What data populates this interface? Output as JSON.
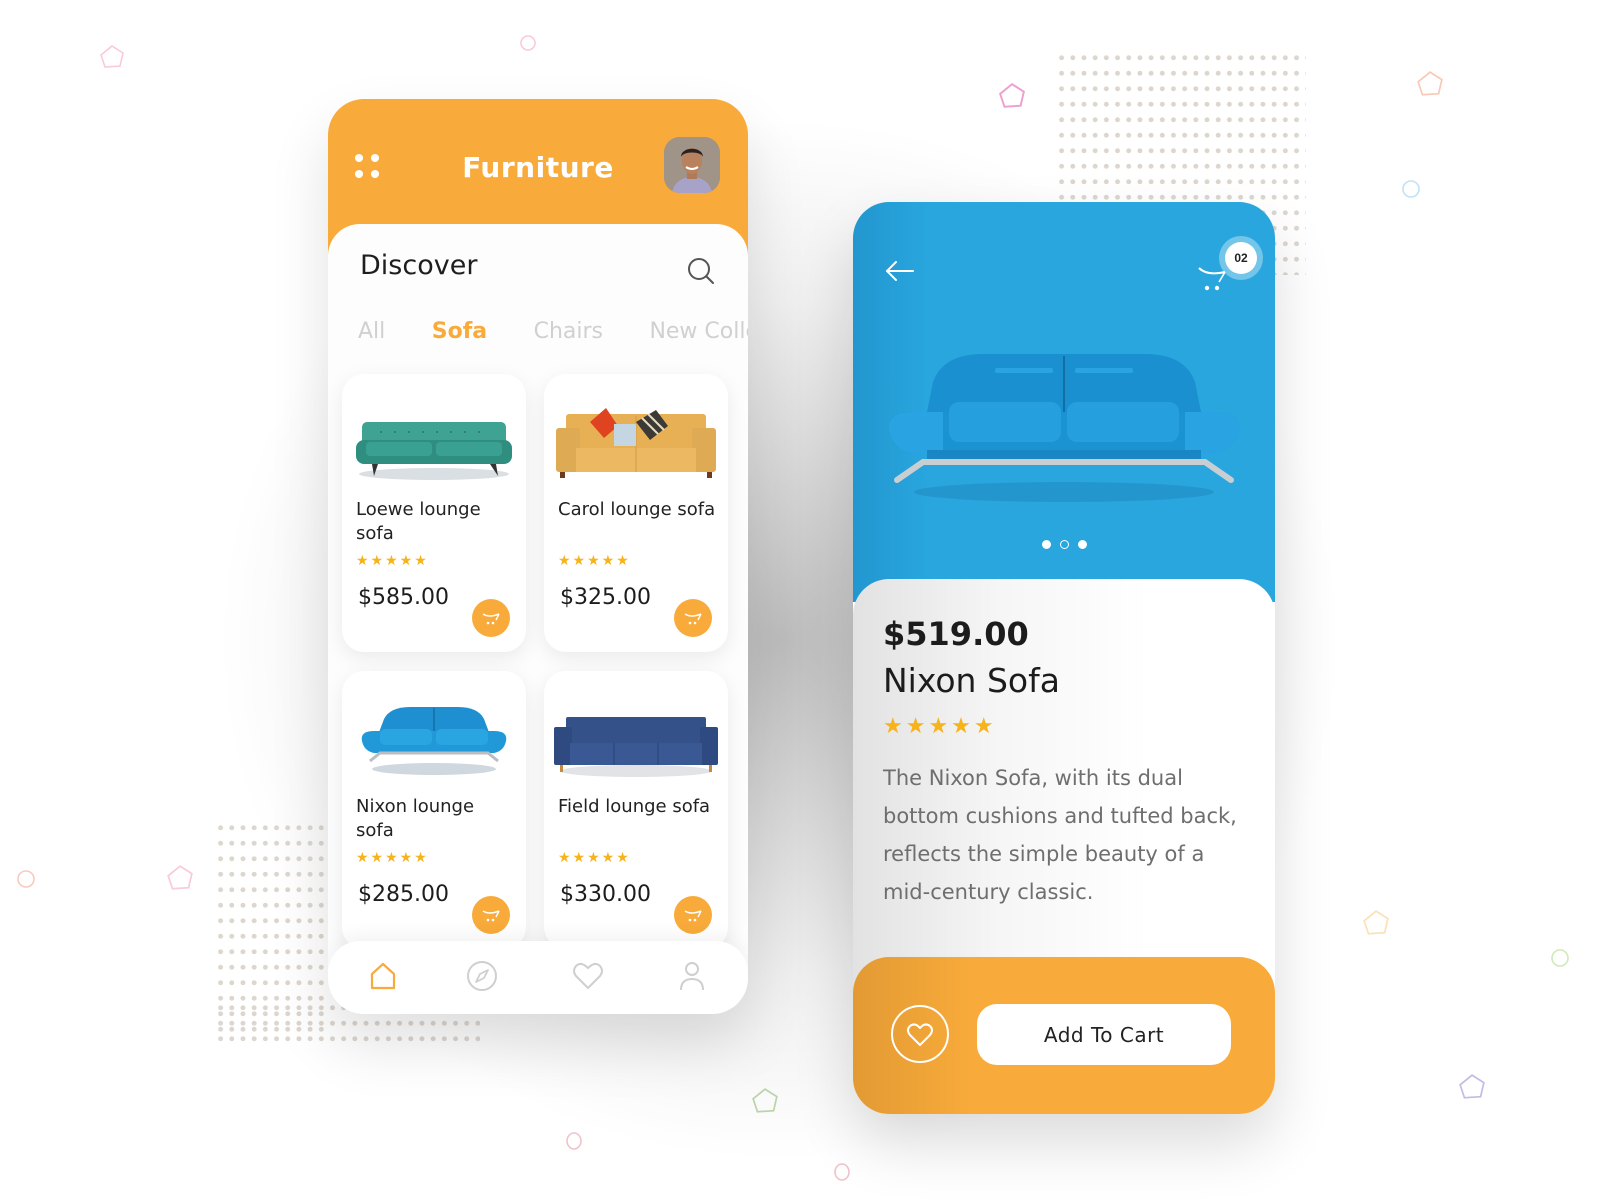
{
  "colors": {
    "accent_orange": "#f8ab3a",
    "hero_blue": "#29a6de",
    "star_yellow": "#f6b31b",
    "text_dark": "#1c1c1c",
    "tab_inactive": "#d0d0d0",
    "desc_gray": "#6e6e6e"
  },
  "list_screen": {
    "header": {
      "title": "Furniture",
      "menu_icon": "grid-dots-icon",
      "avatar": "user-avatar"
    },
    "section_title": "Discover",
    "search_icon": "search-icon",
    "tabs": [
      {
        "label": "All",
        "active": false
      },
      {
        "label": "Sofa",
        "active": true
      },
      {
        "label": "Chairs",
        "active": false
      },
      {
        "label": "New Collection",
        "active": false
      }
    ],
    "products": [
      {
        "name": "Loewe lounge sofa",
        "rating": 5,
        "stars": "★★★★★",
        "price": "$585.00",
        "image": "teal-sofa"
      },
      {
        "name": "Carol lounge sofa",
        "rating": 5,
        "stars": "★★★★★",
        "price": "$325.00",
        "image": "tan-sofa-with-pillows"
      },
      {
        "name": "Nixon lounge sofa",
        "rating": 5,
        "stars": "★★★★★",
        "price": "$285.00",
        "image": "blue-modern-sofa"
      },
      {
        "name": "Field lounge sofa",
        "rating": 5,
        "stars": "★★★★★",
        "price": "$330.00",
        "image": "navy-three-seat-sofa"
      }
    ],
    "bottom_nav": [
      {
        "icon": "home-icon",
        "active": true
      },
      {
        "icon": "compass-icon",
        "active": false
      },
      {
        "icon": "heart-icon",
        "active": false
      },
      {
        "icon": "user-icon",
        "active": false
      }
    ]
  },
  "detail_screen": {
    "back_icon": "arrow-left-icon",
    "cart_count": "02",
    "carousel": {
      "total": 3,
      "active_index": 1
    },
    "price": "$519.00",
    "name": "Nixon Sofa",
    "rating": 5,
    "stars": "★★★★★",
    "description": "The Nixon Sofa, with its dual bottom cushions and tufted back, reflects the simple beauty of a mid-century classic.",
    "favorite_icon": "heart-icon",
    "add_to_cart_label": "Add To Cart"
  }
}
